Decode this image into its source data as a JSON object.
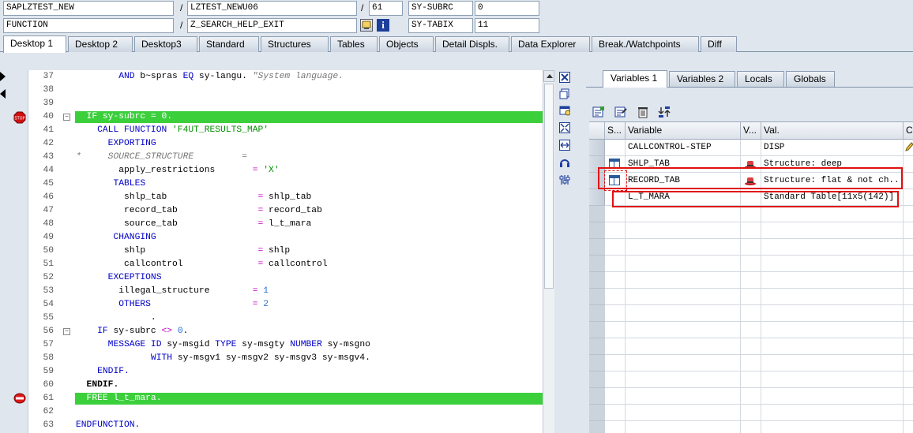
{
  "header": {
    "program": "SAPLZTEST_NEW",
    "include": "LZTEST_NEWU06",
    "line": "61",
    "type": "FUNCTION",
    "event": "Z_SEARCH_HELP_EXIT",
    "sysfields": [
      {
        "name": "SY-SUBRC",
        "value": "0"
      },
      {
        "name": "SY-TABIX",
        "value": "11"
      }
    ]
  },
  "tabs": [
    "Desktop 1",
    "Desktop 2",
    "Desktop3",
    "Standard",
    "Structures",
    "Tables",
    "Objects",
    "Detail Displs.",
    "Data Explorer",
    "Break./Watchpoints",
    "Diff"
  ],
  "active_tab": "Desktop 1",
  "code": [
    {
      "n": "37",
      "t": "        AND b~spras EQ sy-langu. \"System language."
    },
    {
      "n": "38",
      "t": ""
    },
    {
      "n": "39",
      "t": ""
    },
    {
      "n": "40",
      "t": "  IF sy-subrc = 0."
    },
    {
      "n": "41",
      "t": "    CALL FUNCTION 'F4UT_RESULTS_MAP'"
    },
    {
      "n": "42",
      "t": "      EXPORTING"
    },
    {
      "n": "43",
      "t": "*     SOURCE_STRUCTURE         ="
    },
    {
      "n": "44",
      "t": "        apply_restrictions       = 'X'"
    },
    {
      "n": "45",
      "t": "       TABLES"
    },
    {
      "n": "46",
      "t": "         shlp_tab                 = shlp_tab"
    },
    {
      "n": "47",
      "t": "         record_tab               = record_tab"
    },
    {
      "n": "48",
      "t": "         source_tab               = l_t_mara"
    },
    {
      "n": "49",
      "t": "       CHANGING"
    },
    {
      "n": "50",
      "t": "         shlp                     = shlp"
    },
    {
      "n": "51",
      "t": "         callcontrol              = callcontrol"
    },
    {
      "n": "52",
      "t": "      EXCEPTIONS"
    },
    {
      "n": "53",
      "t": "        illegal_structure        = 1"
    },
    {
      "n": "54",
      "t": "        OTHERS                   = 2"
    },
    {
      "n": "55",
      "t": "              ."
    },
    {
      "n": "56",
      "t": "    IF sy-subrc <> 0."
    },
    {
      "n": "57",
      "t": "      MESSAGE ID sy-msgid TYPE sy-msgty NUMBER sy-msgno"
    },
    {
      "n": "58",
      "t": "              WITH sy-msgv1 sy-msgv2 sy-msgv3 sy-msgv4."
    },
    {
      "n": "59",
      "t": "    ENDIF."
    },
    {
      "n": "60",
      "t": "  ENDIF."
    },
    {
      "n": "61",
      "t": "  FREE l_t_mara."
    },
    {
      "n": "62",
      "t": ""
    },
    {
      "n": "63",
      "t": "ENDFUNCTION."
    }
  ],
  "var_tabs": [
    "Variables 1",
    "Variables 2",
    "Locals",
    "Globals"
  ],
  "active_var_tab": "Variables 1",
  "grid_headers": {
    "s": "S...",
    "variable": "Variable",
    "v": "V...",
    "val": "Val.",
    "c": "C..."
  },
  "variables": [
    {
      "name": "CALLCONTROL-STEP",
      "value": "DISP",
      "icon": "none"
    },
    {
      "name": "SHLP_TAB",
      "value": "Structure: deep",
      "icon": "table-icon"
    },
    {
      "name": "RECORD_TAB",
      "value": "Structure: flat & not ch...",
      "icon": "table-icon"
    },
    {
      "name": "L_T_MARA",
      "value": "Standard Table[11x5(142)]",
      "icon": "none"
    }
  ],
  "colors": {
    "highlight": "#3ccf3c",
    "annotation": "#e01010",
    "keyword": "#0000c8",
    "string": "#009000"
  }
}
